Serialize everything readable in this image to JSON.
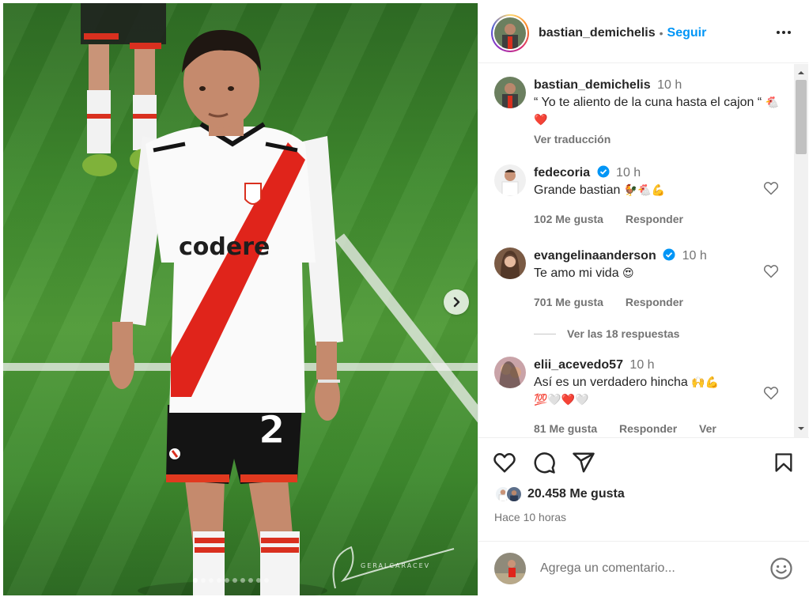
{
  "post": {
    "username": "bastian_demichelis",
    "separator": "•",
    "follow_label": "Seguir",
    "likes_count": "20.458 Me gusta",
    "posted_ago": "Hace 10 horas",
    "carousel_total": 10,
    "carousel_active": 1
  },
  "caption": {
    "username": "bastian_demichelis",
    "time": "10 h",
    "text": "“ Yo te aliento de la cuna hasta el cajon “",
    "emojis": "🐔❤️",
    "translate_label": "Ver traducción"
  },
  "comments": [
    {
      "username": "fedecoria",
      "verified": true,
      "time": "10 h",
      "text": "Grande bastian",
      "emojis": "🐓🐔💪",
      "likes": "102 Me gusta",
      "reply_label": "Responder"
    },
    {
      "username": "evangelinaanderson",
      "verified": true,
      "time": "10 h",
      "text": "Te amo mi vida",
      "emojis": "😍",
      "likes": "701 Me gusta",
      "reply_label": "Responder",
      "replies_label": "Ver las 18 respuestas"
    },
    {
      "username": "elii_acevedo57",
      "verified": false,
      "time": "10 h",
      "text": "Así es un verdadero hincha",
      "emojis": "🙌💪",
      "emojis_line2": "💯🤍❤️🤍",
      "likes": "81 Me gusta",
      "reply_label": "Responder",
      "translate_label": "Ver traducción"
    }
  ],
  "add_comment": {
    "placeholder": "Agrega un comentario..."
  },
  "photo": {
    "jersey_sponsor": "codere",
    "shirt_number": "2",
    "watermark": "GERALCARACEV"
  },
  "colors": {
    "link_blue": "#0095f6",
    "verified_blue": "#0095f6",
    "heart_red": "#ed4956",
    "muted": "#737373"
  },
  "icons": [
    "more-icon",
    "heart-icon",
    "comment-icon",
    "share-icon",
    "bookmark-icon",
    "smiley-icon",
    "chevron-right-icon",
    "verified-icon"
  ]
}
